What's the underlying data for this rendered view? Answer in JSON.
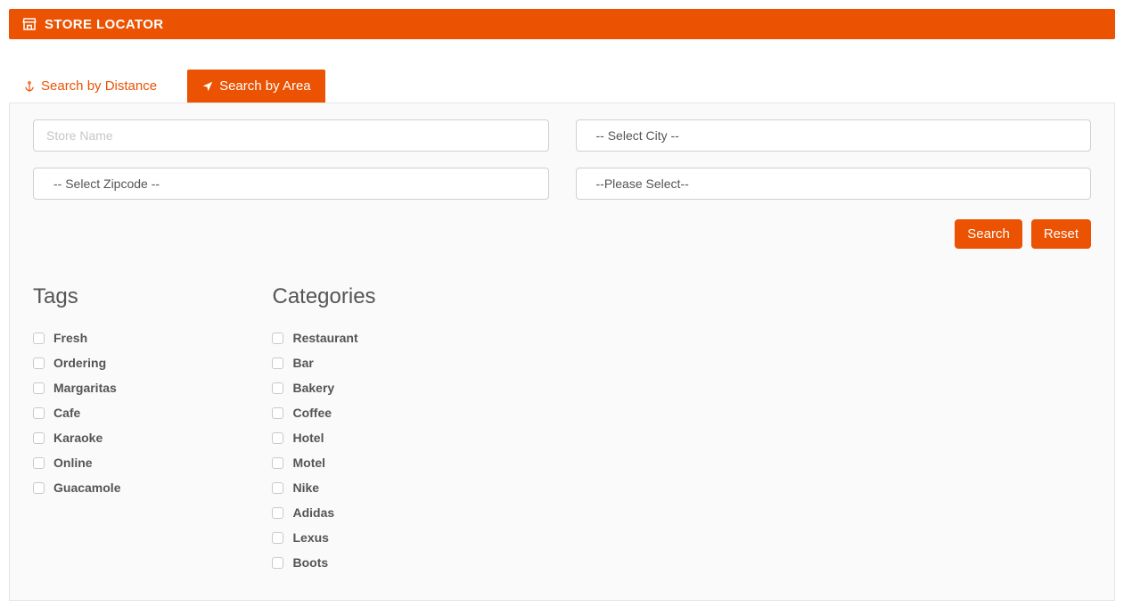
{
  "header": {
    "title": "STORE LOCATOR"
  },
  "tabs": {
    "distance": "Search by Distance",
    "area": "Search by Area"
  },
  "form": {
    "store_name_placeholder": "Store Name",
    "city_placeholder": "-- Select City --",
    "zip_placeholder": "-- Select Zipcode --",
    "generic_placeholder": "--Please Select--"
  },
  "buttons": {
    "search": "Search",
    "reset": "Reset"
  },
  "filters": {
    "tags_heading": "Tags",
    "categories_heading": "Categories",
    "tags": [
      "Fresh",
      "Ordering",
      "Margaritas",
      "Cafe",
      "Karaoke",
      "Online",
      "Guacamole"
    ],
    "categories": [
      "Restaurant",
      "Bar",
      "Bakery",
      "Coffee",
      "Hotel",
      "Motel",
      "Nike",
      "Adidas",
      "Lexus",
      "Boots"
    ]
  },
  "colors": {
    "brand": "#eb5202"
  }
}
